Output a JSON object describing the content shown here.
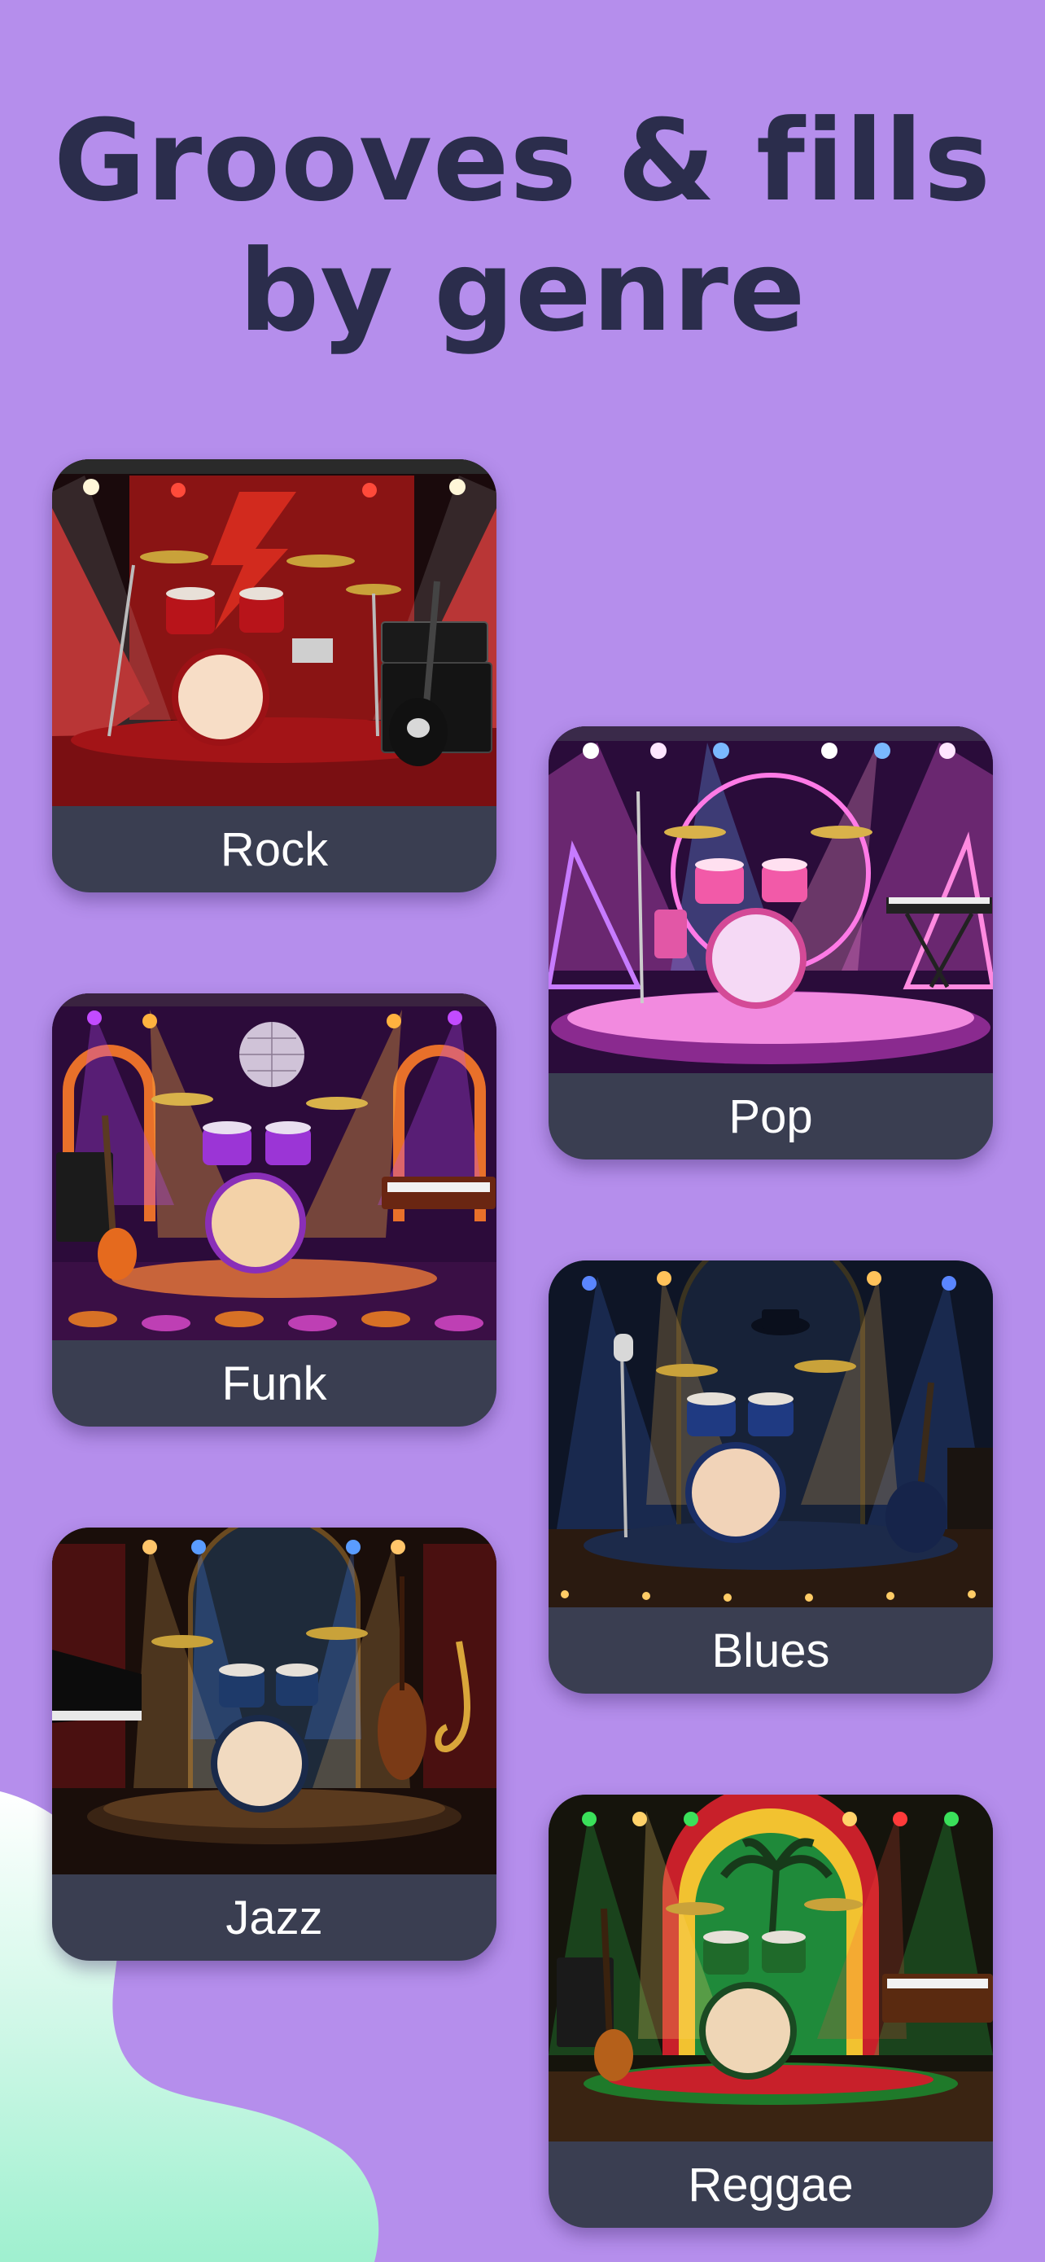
{
  "header": {
    "title_line1": "Grooves & fills",
    "title_line2": "by genre"
  },
  "genres": [
    {
      "label": "Rock"
    },
    {
      "label": "Pop"
    },
    {
      "label": "Funk"
    },
    {
      "label": "Blues"
    },
    {
      "label": "Jazz"
    },
    {
      "label": "Reggae"
    }
  ],
  "colors": {
    "background": "#b58eec",
    "title": "#2b2d4c",
    "card_footer": "#3a3e51",
    "label": "#ffffff",
    "blob": "#bff3df"
  }
}
